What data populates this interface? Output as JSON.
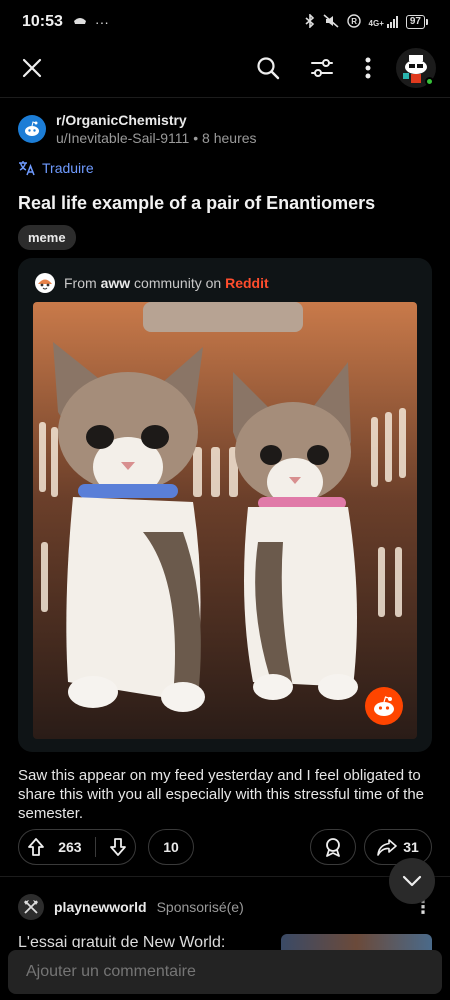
{
  "status_bar": {
    "time": "10:53",
    "network": "4G+",
    "battery": "97"
  },
  "post": {
    "subreddit": "r/OrganicChemistry",
    "author": "u/Inevitable-Sail-9111",
    "age": "8 heures",
    "translate_label": "Traduire",
    "title": "Real life example of a pair of Enantiomers",
    "flair": "meme",
    "embed": {
      "from_prefix": "From",
      "community": "aww",
      "community_mid": "community on",
      "platform": "Reddit"
    },
    "body": "Saw this appear on my feed yesterday and I feel obligated to share this with you all especially with this stressful time of the semester.",
    "upvotes": "263",
    "comments": "10",
    "shares": "31"
  },
  "sponsored": {
    "name": "playnewworld",
    "tag": "Sponsorisé(e)",
    "headline": "L'essai gratuit de New World:"
  },
  "comment_bar": {
    "placeholder": "Ajouter un commentaire"
  },
  "colors": {
    "accent_blue": "#6f9bff",
    "reddit_orange": "#ff4500",
    "background": "#000000"
  }
}
